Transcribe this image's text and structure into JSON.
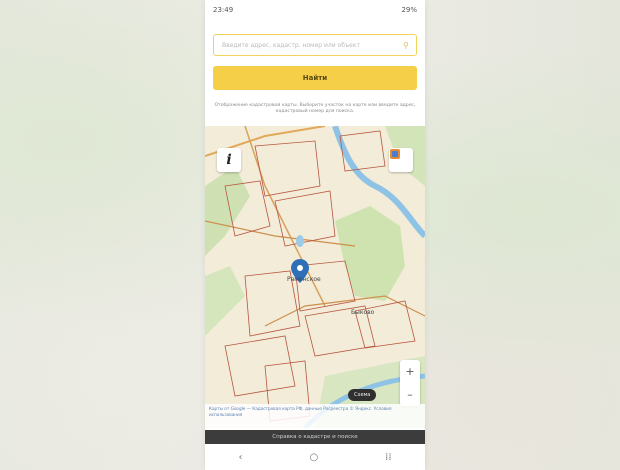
{
  "status_bar": {
    "time": "23:49",
    "battery": "29%"
  },
  "search": {
    "placeholder": "Введите адрес, кадастр. номер или объект"
  },
  "find_button": {
    "label": "Найти"
  },
  "hint_text": "Отображение кадастровой карты. Выберите участок на карте или введите адрес, кадастровый номер для поиска.",
  "map": {
    "labels": [
      {
        "text": "Раменское"
      },
      {
        "text": "Быково"
      }
    ],
    "info_label": "i",
    "zoom_in": "+",
    "zoom_out": "–",
    "layer_chip": "Схема",
    "attribution": "Карты от Google — Кадастровая карта РФ, данные Росреестра © Яндекс. Условия использования"
  },
  "bottom_bar": {
    "text": "Справка о кадастре и поиске"
  },
  "nav": {
    "back": "‹",
    "home": "○",
    "recents": "⁞⁞"
  },
  "colors": {
    "accent": "#f5cf48",
    "map_bg": "#f2ecd9",
    "pin": "#2e6fb7"
  }
}
